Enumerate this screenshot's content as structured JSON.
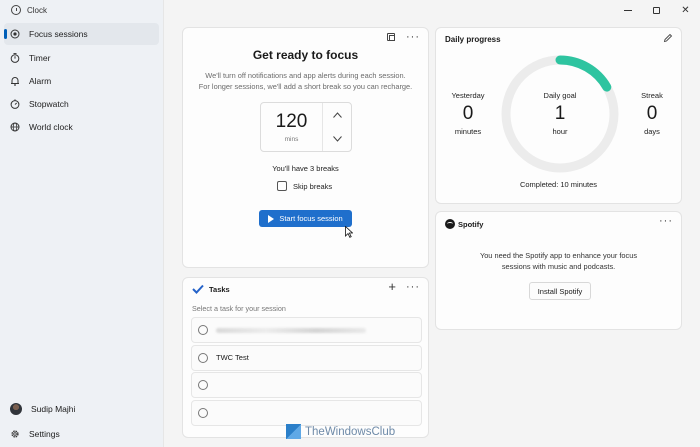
{
  "app": {
    "title": "Clock"
  },
  "sidebar": {
    "items": [
      {
        "label": "Focus sessions",
        "icon": "focus-icon",
        "active": true
      },
      {
        "label": "Timer",
        "icon": "timer-icon",
        "active": false
      },
      {
        "label": "Alarm",
        "icon": "alarm-icon",
        "active": false
      },
      {
        "label": "Stopwatch",
        "icon": "stopwatch-icon",
        "active": false
      },
      {
        "label": "World clock",
        "icon": "globe-icon",
        "active": false
      }
    ],
    "user": {
      "name": "Sudip Majhi"
    },
    "settings_label": "Settings"
  },
  "focus": {
    "title": "Get ready to focus",
    "description_line1": "We'll turn off notifications and app alerts during each session.",
    "description_line2": "For longer sessions, we'll add a short break so you can recharge.",
    "minutes_value": "120",
    "minutes_unit": "mins",
    "breaks_text": "You'll have 3 breaks",
    "skip_breaks_label": "Skip breaks",
    "skip_breaks_checked": false,
    "start_button": "Start focus session"
  },
  "progress": {
    "title": "Daily progress",
    "yesterday": {
      "label": "Yesterday",
      "value": "0",
      "unit": "minutes"
    },
    "goal": {
      "label": "Daily goal",
      "value": "1",
      "unit": "hour"
    },
    "streak": {
      "label": "Streak",
      "value": "0",
      "unit": "days"
    },
    "completed_text": "Completed: 10 minutes",
    "completed_fraction": 0.1667,
    "accent_color": "#2ec4a0"
  },
  "spotify": {
    "brand": "Spotify",
    "message_line1": "You need the Spotify app to enhance your focus",
    "message_line2": "sessions with music and podcasts.",
    "install_button": "Install Spotify"
  },
  "tasks": {
    "title": "Tasks",
    "hint": "Select a task for your session",
    "items": [
      {
        "label": "",
        "blurred": true
      },
      {
        "label": "TWC Test",
        "blurred": false
      },
      {
        "label": "",
        "blurred": false
      },
      {
        "label": "",
        "blurred": false
      }
    ]
  },
  "watermark": {
    "text": "TheWindowsClub"
  },
  "colors": {
    "primary": "#1f6fcc",
    "accent": "#2ec4a0",
    "sidebar_bg": "#eef1f5"
  }
}
